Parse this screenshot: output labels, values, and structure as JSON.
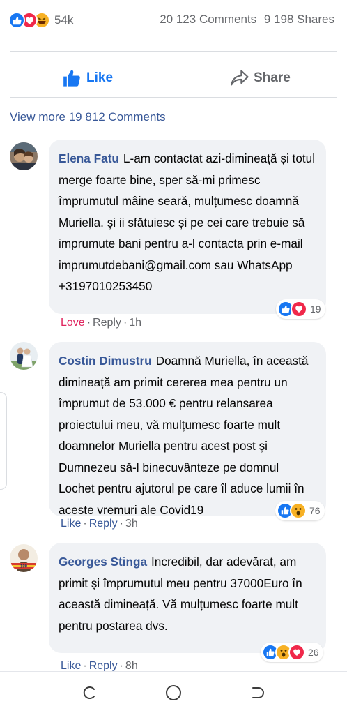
{
  "stats": {
    "reaction_icons": [
      "like-icon",
      "love-icon",
      "haha-icon"
    ],
    "reaction_count": "54k",
    "comments": "20 123 Comments",
    "shares": "9 198 Shares"
  },
  "actions": {
    "like_label": "Like",
    "share_label": "Share"
  },
  "view_more": "View more 19 812 Comments",
  "comments": [
    {
      "author": "Elena Fatu",
      "text": "L-am contactat azi-dimineață și totul merge foarte bine, sper să-mi primesc împrumutul mâine seară, mulțumesc doamnă Muriella. și ii sfătuiesc și pe cei care trebuie să imprumute bani pentru a-l contacta prin e-mail imprumutdebani@gmail.com sau WhatsApp +3197010253450",
      "reaction_count": "19",
      "reactions": [
        "like-icon",
        "love-icon"
      ],
      "action": "Love",
      "reply": "Reply",
      "time": "1h"
    },
    {
      "author": "Costin Dimustru",
      "text": "Doamnă Muriella, în această dimineață am primit cererea mea pentru un împrumut de 53.000 € pentru relansarea proiectului meu, vă mulțumesc foarte mult doamnelor Muriella pentru acest post și Dumnezeu să-l binecuvânteze pe domnul Lochet pentru ajutorul pe care îl aduce lumii în aceste vremuri ale Covid19",
      "reaction_count": "76",
      "reactions": [
        "like-icon",
        "wow-icon"
      ],
      "action": "Like",
      "reply": "Reply",
      "time": "3h"
    },
    {
      "author": "Georges Stinga",
      "text": "Incredibil, dar adevărat, am primit și împrumutul meu pentru 37000Euro în această dimineață. Vă mulțumesc foarte mult pentru postarea dvs.",
      "reaction_count": "26",
      "reactions": [
        "like-icon",
        "wow-icon",
        "love-icon"
      ],
      "action": "Like",
      "reply": "Reply",
      "time": "8h"
    }
  ],
  "colors": {
    "brand_blue": "#1877f2",
    "link_blue": "#385898",
    "love_red": "#e0245e",
    "bubble_bg": "#f0f2f5",
    "muted": "#65676b"
  },
  "navbar": {
    "icons": [
      "recents-icon",
      "home-icon",
      "back-icon"
    ]
  }
}
